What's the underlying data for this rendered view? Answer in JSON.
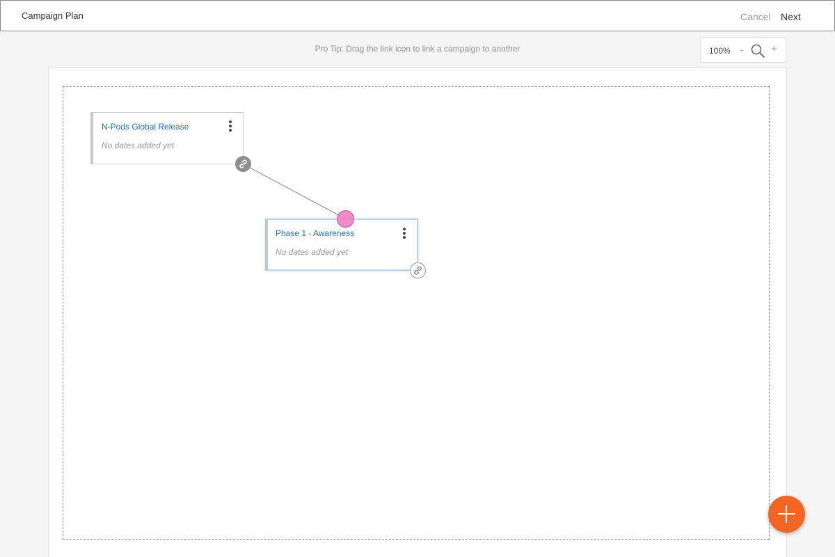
{
  "header": {
    "title": "Campaign Plan",
    "cancel_label": "Cancel",
    "next_label": "Next"
  },
  "toolbar": {
    "protip": "Pro Tip: Drag the link icon to link a campaign to another",
    "zoom_level": "100%",
    "zoom_out_label": "-",
    "zoom_in_label": "+",
    "search_icon": "search-icon"
  },
  "cards": [
    {
      "title": "N-Pods Global Release",
      "subtitle": "No dates added yet"
    },
    {
      "title": "Phase 1 -  Awareness",
      "subtitle": "No dates added yet"
    }
  ],
  "icons": {
    "menu": "kebab-menu-icon",
    "link": "link-icon",
    "add": "plus-icon"
  },
  "colors": {
    "accent": "#f26522",
    "link_text": "#1f6fb2",
    "drop_target": "#ee86c4"
  }
}
